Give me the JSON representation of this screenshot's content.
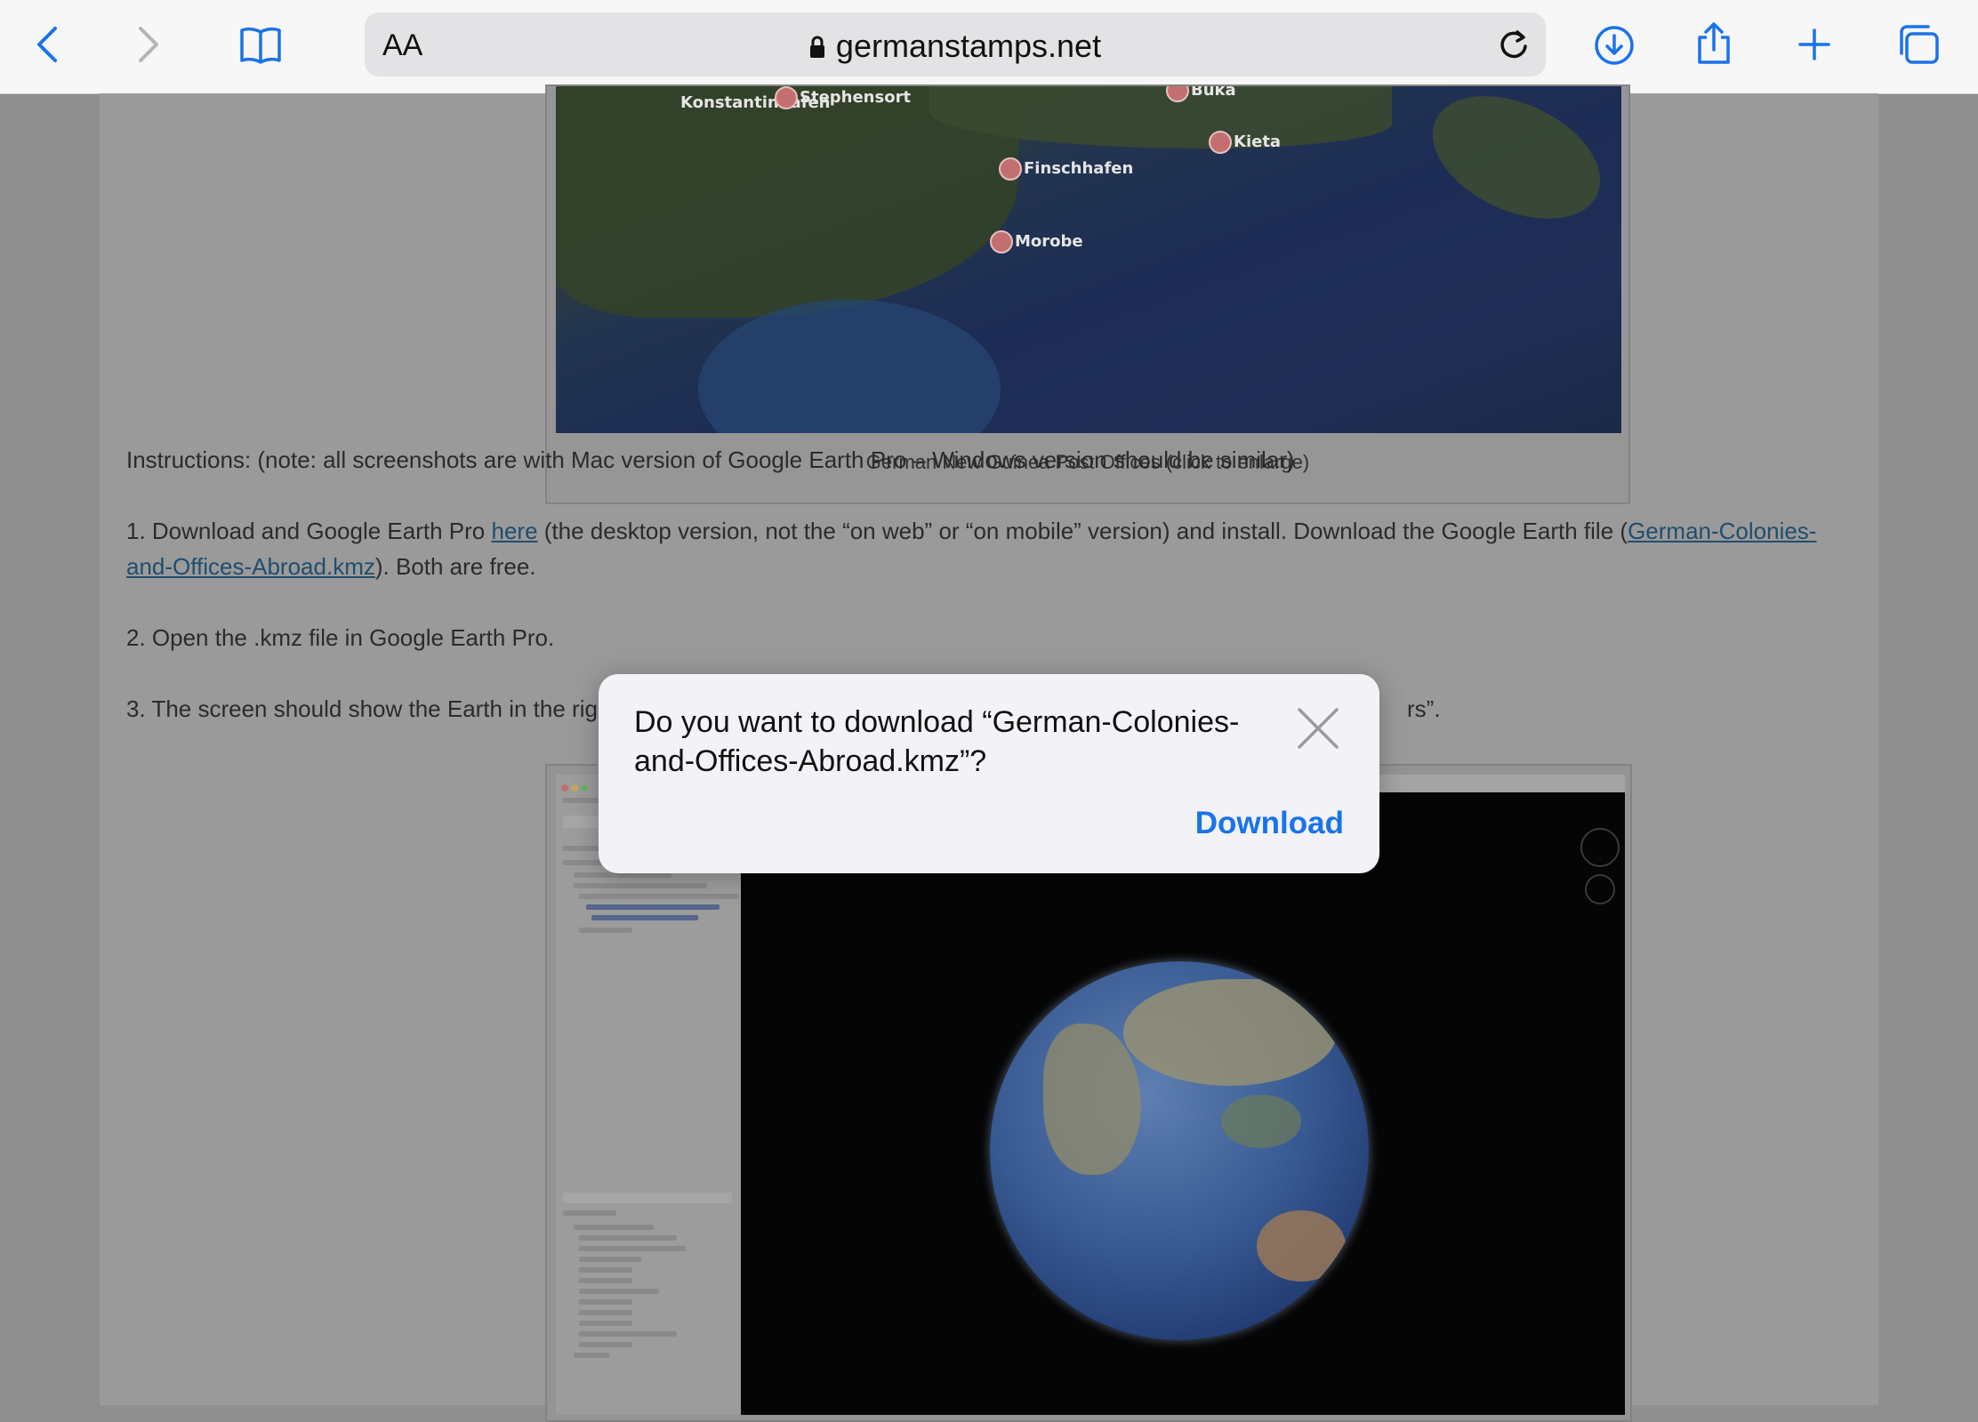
{
  "browser": {
    "text_size_button": "AA",
    "url": "germanstamps.net"
  },
  "page": {
    "map_labels": [
      "Konstantinhafen",
      "Stephensort",
      "Buka",
      "Kieta",
      "Finschhafen",
      "Morobe"
    ],
    "map_caption": "German New Guinea Post Offices (click to enlarge)",
    "intro": "Instructions: (note: all screenshots are with Mac version of Google Earth Pro – Windows version should be similar)",
    "step1": {
      "before": "1. Download and Google Earth Pro ",
      "link1": "here",
      "middle": " (the desktop version, not the “on web” or “on mobile” version) and install. Download the Google Earth file (",
      "link2": "German-Colonies-and-Offices-Abroad.kmz",
      "after": "). Both are free."
    },
    "step2": "2. Open the .kmz file in Google Earth Pro.",
    "step3_left": "3. The screen should show the Earth in the rig",
    "step3_right": "rs”."
  },
  "dialog": {
    "message": "Do you want to download “German-Colonies-and-Offices-Abroad.kmz”?",
    "download_label": "Download"
  },
  "colors": {
    "accent": "#1a73e8",
    "link": "#1f4e6e"
  }
}
